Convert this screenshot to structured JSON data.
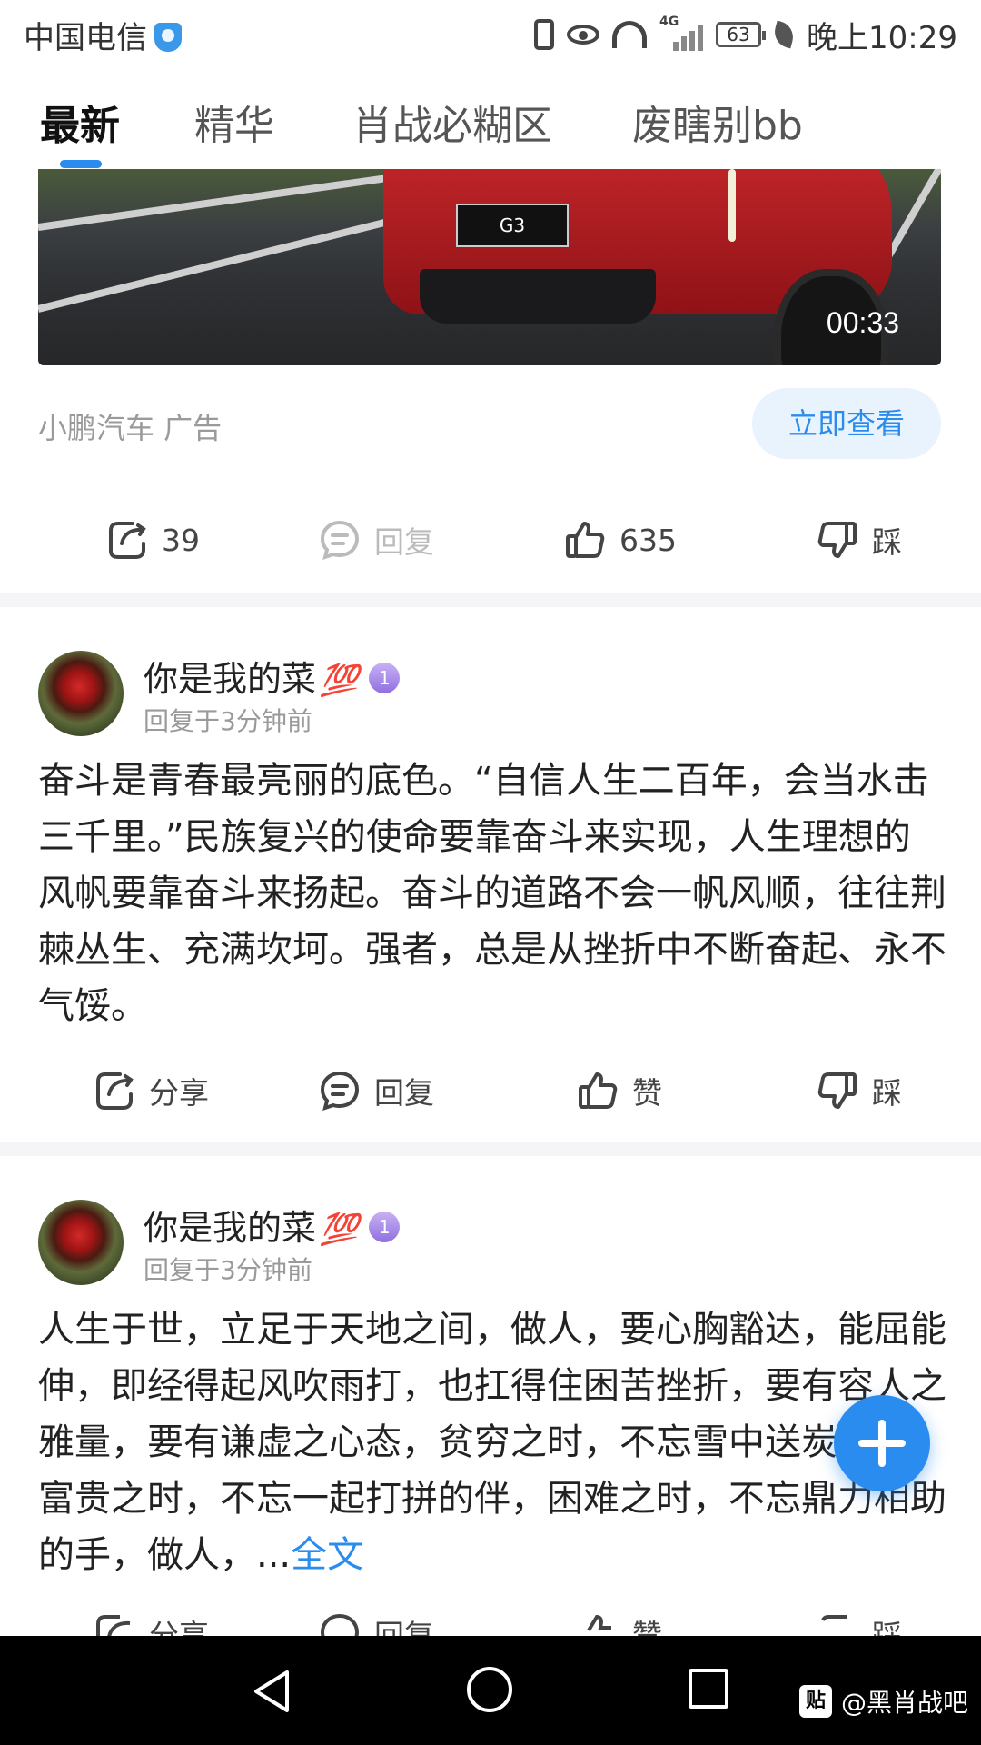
{
  "status_bar": {
    "carrier": "中国电信",
    "network": "4G",
    "battery": "63",
    "time": "晚上10:29"
  },
  "tabs": [
    {
      "label": "最新",
      "active": true
    },
    {
      "label": "精华",
      "active": false
    },
    {
      "label": "肖战必糊区",
      "active": false
    },
    {
      "label": "废瞎别bb",
      "active": false
    }
  ],
  "ad": {
    "plate": "G3",
    "duration": "00:33",
    "meta": "小鹏汽车  广告",
    "cta": "立即查看",
    "actions": {
      "share": "39",
      "reply": "回复",
      "like": "635",
      "dislike": "踩"
    }
  },
  "posts": [
    {
      "username": "你是我的菜",
      "emoji": "💯",
      "level": "1",
      "time": "回复于3分钟前",
      "body": "奋斗是青春最亮丽的底色。“自信人生二百年，会当水击三千里。”民族复兴的使命要靠奋斗来实现，人生理想的风帆要靠奋斗来扬起。奋斗的道路不会一帆风顺，往往荆棘丛生、充满坎坷。强者，总是从挫折中不断奋起、永不气馁。",
      "actions": {
        "share": "分享",
        "reply": "回复",
        "like": "赞",
        "dislike": "踩"
      }
    },
    {
      "username": "你是我的菜",
      "emoji": "💯",
      "level": "1",
      "time": "回复于3分钟前",
      "body": "人生于世，立足于天地之间，做人，要心胸豁达，能屈能伸，即经得起风吹雨打，也扛得住困苦挫折，要有容人之雅量，要有谦虚之心态，贫穷之时，不忘雪中送炭之情，富贵之时，不忘一起打拼的伴，困难之时，不忘鼎力相助的手，做人，...",
      "more": "全文",
      "actions": {
        "share": "分享",
        "reply": "回复",
        "like": "赞",
        "dislike": "踩"
      }
    }
  ],
  "watermark": {
    "logo": "贴",
    "text": "@黑肖战吧"
  },
  "colors": {
    "accent": "#2b8cf0",
    "muted": "#9a9a9a"
  }
}
